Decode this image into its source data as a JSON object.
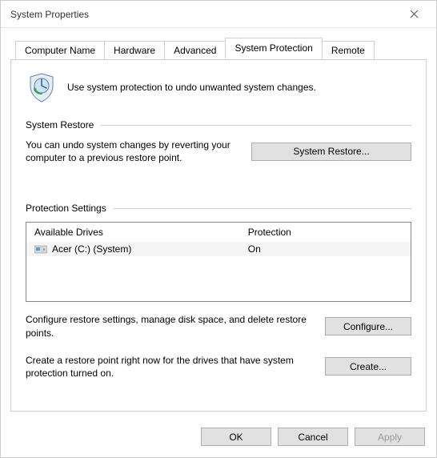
{
  "window": {
    "title": "System Properties"
  },
  "tabs": {
    "computer_name": "Computer Name",
    "hardware": "Hardware",
    "advanced": "Advanced",
    "system_protection": "System Protection",
    "remote": "Remote"
  },
  "intro_text": "Use system protection to undo unwanted system changes.",
  "groups": {
    "system_restore": {
      "title": "System Restore",
      "desc": "You can undo system changes by reverting your computer to a previous restore point.",
      "button": "System Restore..."
    },
    "protection_settings": {
      "title": "Protection Settings",
      "columns": {
        "drives": "Available Drives",
        "protection": "Protection"
      },
      "rows": [
        {
          "drive": "Acer (C:) (System)",
          "protection": "On"
        }
      ],
      "configure_desc": "Configure restore settings, manage disk space, and delete restore points.",
      "configure_button": "Configure...",
      "create_desc": "Create a restore point right now for the drives that have system protection turned on.",
      "create_button": "Create..."
    }
  },
  "buttons": {
    "ok": "OK",
    "cancel": "Cancel",
    "apply": "Apply"
  }
}
